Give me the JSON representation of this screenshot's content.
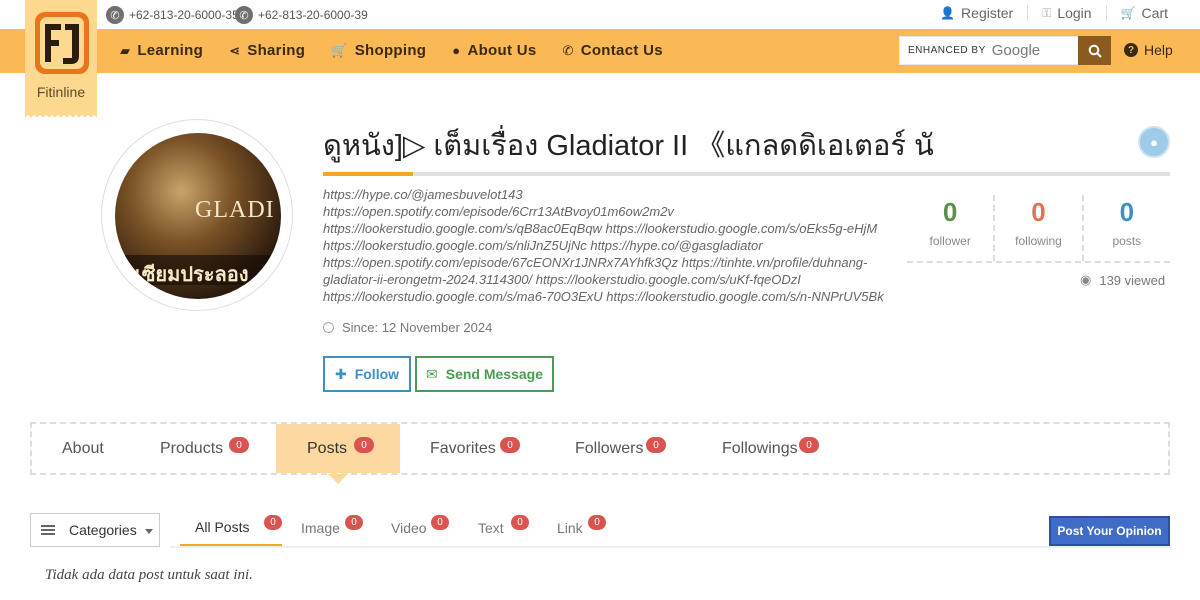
{
  "topbar": {
    "phones": [
      "+62-813-20-6000-35",
      "+62-813-20-6000-39"
    ],
    "links": [
      {
        "label": "Register",
        "icon": "user-icon"
      },
      {
        "label": "Login",
        "icon": "key-icon"
      },
      {
        "label": "Cart",
        "icon": "cart-icon"
      }
    ]
  },
  "logo": {
    "brand": "Fitinline"
  },
  "nav": {
    "items": [
      {
        "label": "Learning",
        "icon": "book-icon"
      },
      {
        "label": "Sharing",
        "icon": "share-icon"
      },
      {
        "label": "Shopping",
        "icon": "cart-icon"
      },
      {
        "label": "About Us",
        "icon": "user-icon"
      },
      {
        "label": "Contact Us",
        "icon": "phone-icon"
      }
    ],
    "search": {
      "enhanced_label": "ENHANCED BY",
      "google": "Google"
    },
    "help": "Help"
  },
  "colors": {
    "nav_bg": "#fbb955",
    "accent": "#f5a623",
    "follow": "#3d8fc4",
    "message": "#4a9c55",
    "badge": "#d9534f"
  },
  "profile": {
    "title": "ดูหนัง]▷ เต็มเรื่อง Gladiator II 《แกลดดิเอเตอร์ นั",
    "avatar_text_1": "GLADI",
    "avatar_text_2": "เซียมประลอง",
    "bio_lines": [
      "https://hype.co/@jamesbuvelot143",
      "https://open.spotify.com/episode/6Crr13AtBvoy01m6ow2m2v",
      "https://lookerstudio.google.com/s/qB8ac0EqBqw https://lookerstudio.google.com/s/oEks5g-eHjM",
      "https://lookerstudio.google.com/s/nliJnZ5UjNc https://hype.co/@gasgladiator",
      "https://open.spotify.com/episode/67cEONXr1JNRx7AYhfk3Qz https://tinhte.vn/profile/duhnang-",
      "gladiator-ii-erongetm-2024.3114300/ https://lookerstudio.google.com/s/uKf-fqeODzI",
      "https://lookerstudio.google.com/s/ma6-70O3ExU https://lookerstudio.google.com/s/n-NNPrUV5Bk"
    ],
    "since": "Since: 12 November 2024",
    "follow": "Follow",
    "message": "Send Message",
    "stats": [
      {
        "value": "0",
        "label": "follower",
        "color": "#5a8f4e"
      },
      {
        "value": "0",
        "label": "following",
        "color": "#e0744f"
      },
      {
        "value": "0",
        "label": "posts",
        "color": "#3d8fc4"
      }
    ],
    "viewed": "139 viewed"
  },
  "tabs": [
    {
      "label": "About"
    },
    {
      "label": "Products",
      "count": "0"
    },
    {
      "label": "Posts",
      "count": "0"
    },
    {
      "label": "Favorites",
      "count": "0"
    },
    {
      "label": "Followers",
      "count": "0"
    },
    {
      "label": "Followings",
      "count": "0"
    }
  ],
  "categories": "Categories",
  "subtabs": [
    {
      "label": "All Posts",
      "count": "0"
    },
    {
      "label": "Image",
      "count": "0"
    },
    {
      "label": "Video",
      "count": "0"
    },
    {
      "label": "Text",
      "count": "0"
    },
    {
      "label": "Link",
      "count": "0"
    }
  ],
  "post_button": "Post Your Opinion",
  "empty_message": "Tidak ada data post untuk saat ini."
}
